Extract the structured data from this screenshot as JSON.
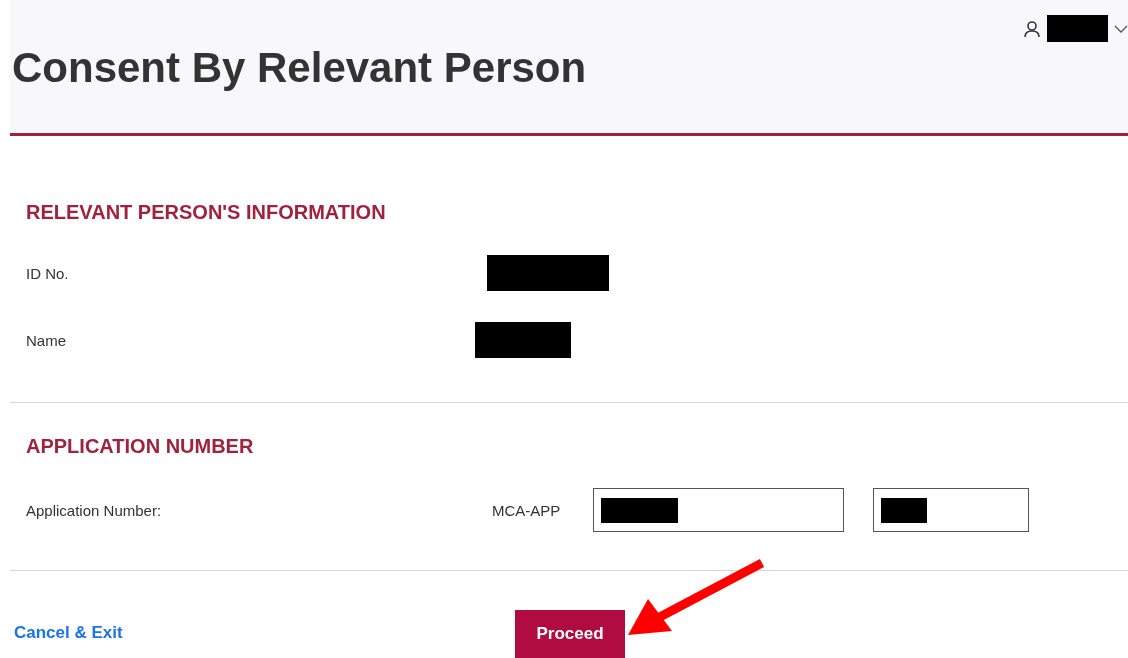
{
  "page": {
    "title": "Consent By Relevant Person"
  },
  "sections": [
    {
      "heading": "RELEVANT PERSON'S INFORMATION",
      "kind": "info",
      "rows": [
        {
          "label": "ID No."
        },
        {
          "label": "Name"
        }
      ]
    },
    {
      "heading": "APPLICATION NUMBER",
      "kind": "application",
      "rows": [
        {
          "label": "Application Number:",
          "prefix": "MCA-APP"
        }
      ]
    }
  ],
  "footer": {
    "cancel_link": "Cancel & Exit",
    "proceed_button": "Proceed"
  }
}
